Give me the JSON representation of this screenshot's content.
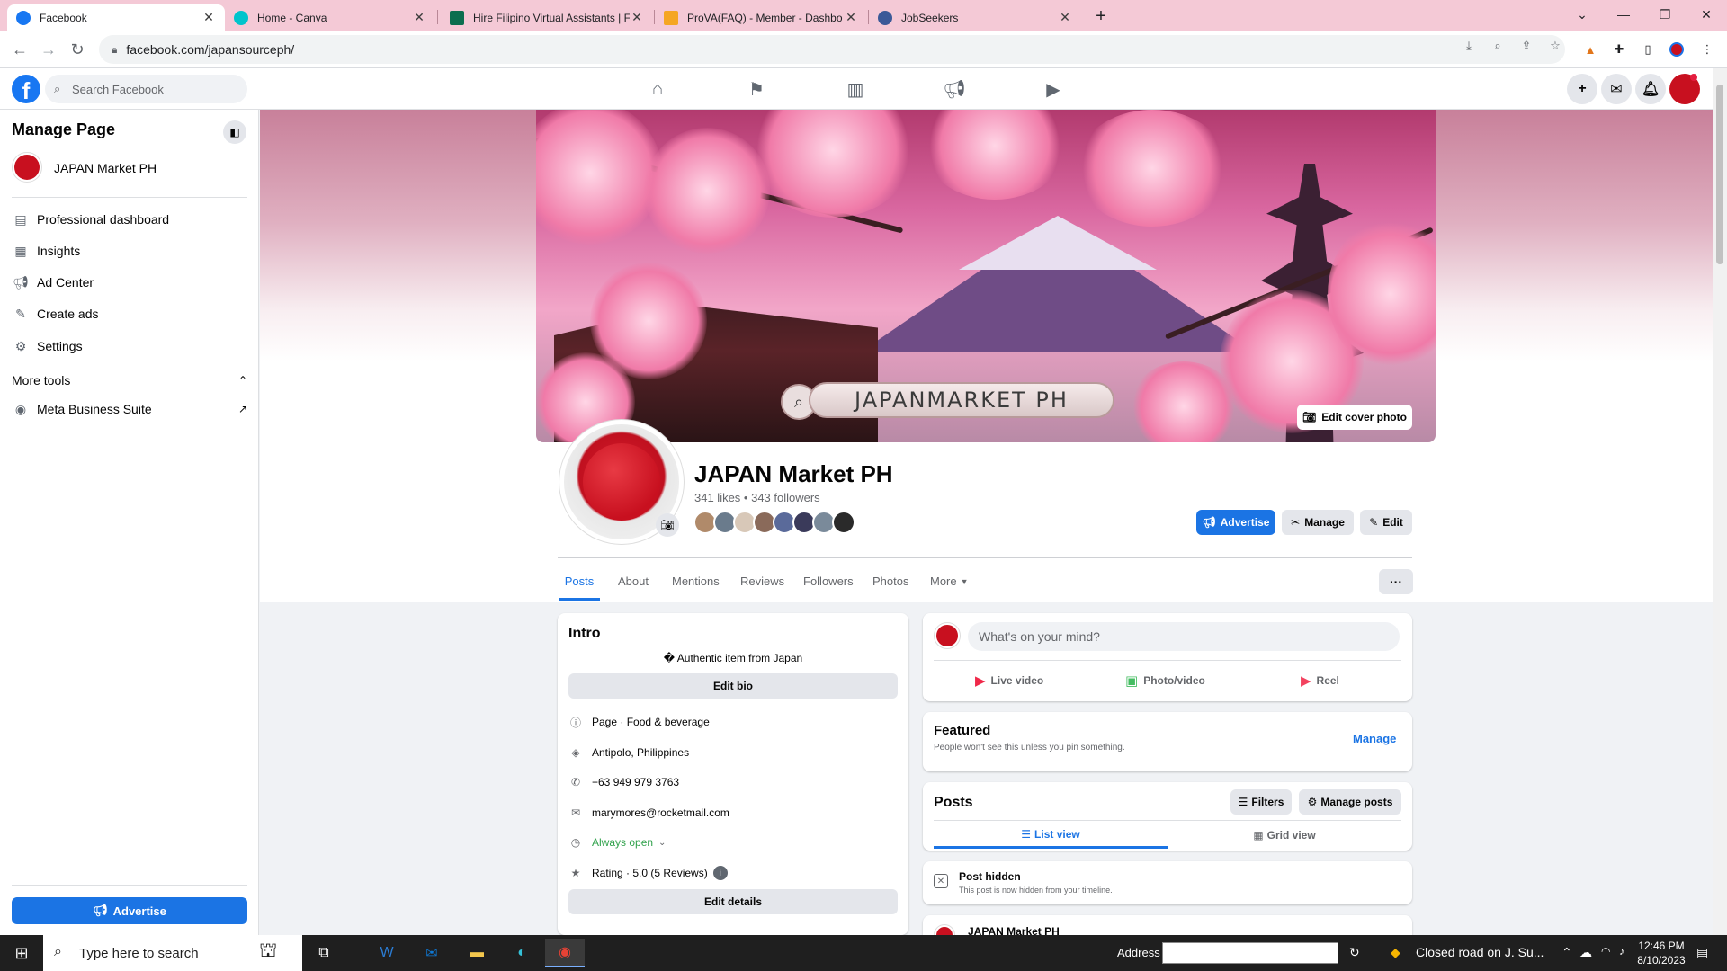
{
  "browser": {
    "tabs": [
      {
        "title": "Facebook",
        "active": true,
        "favicon_color": "#1877f2"
      },
      {
        "title": "Home - Canva",
        "active": false,
        "favicon_color": "#00c4cc"
      },
      {
        "title": "Hire Filipino Virtual Assistants | Fi",
        "active": false,
        "favicon_color": "#0b6e4f"
      },
      {
        "title": "ProVA(FAQ) - Member - Dashbo",
        "active": false,
        "favicon_color": "#f5a623"
      },
      {
        "title": "JobSeekers",
        "active": false,
        "favicon_color": "#3b5998"
      }
    ],
    "url": "facebook.com/japansourceph/"
  },
  "facebook": {
    "search_placeholder": "Search Facebook",
    "brand_color": "#1877f2"
  },
  "sidebar": {
    "title": "Manage Page",
    "page_name": "JAPAN Market PH",
    "items": [
      {
        "label": "Professional dashboard",
        "icon": "dashboard-icon"
      },
      {
        "label": "Insights",
        "icon": "insights-icon"
      },
      {
        "label": "Ad Center",
        "icon": "megaphone-icon"
      },
      {
        "label": "Create ads",
        "icon": "pencil-icon"
      },
      {
        "label": "Settings",
        "icon": "gear-icon"
      }
    ],
    "more_tools_label": "More tools",
    "meta_suite_label": "Meta Business Suite",
    "advertise_label": "Advertise"
  },
  "cover": {
    "banner_text": "JAPANMARKET PH",
    "edit_cover_label": "Edit cover photo"
  },
  "profile": {
    "name": "JAPAN Market PH",
    "stats": "341 likes • 343 followers",
    "follower_avatar_colors": [
      "#b08a6a",
      "#6a7b8c",
      "#d8c8b8",
      "#8a6a5a",
      "#5a6a9a",
      "#3a3a5a",
      "#7a8a9a",
      "#2a2a2a"
    ],
    "buttons": {
      "advertise": "Advertise",
      "manage": "Manage",
      "edit": "Edit"
    },
    "tabs": [
      "Posts",
      "About",
      "Mentions",
      "Reviews",
      "Followers",
      "Photos",
      "More"
    ],
    "active_tab": "Posts"
  },
  "intro": {
    "title": "Intro",
    "bio": "� Authentic item from Japan",
    "edit_bio_label": "Edit bio",
    "rows": [
      {
        "text": "Page · Food & beverage",
        "icon": "info-icon"
      },
      {
        "text": "Antipolo, Philippines",
        "icon": "location-icon"
      },
      {
        "text": "+63 949 979 3763",
        "icon": "phone-icon"
      },
      {
        "text": "marymores@rocketmail.com",
        "icon": "mail-icon"
      },
      {
        "text": "Always open",
        "icon": "clock-icon"
      },
      {
        "text": "Rating · 5.0 (5 Reviews)",
        "icon": "star-icon"
      }
    ],
    "edit_details_label": "Edit details"
  },
  "composer": {
    "placeholder": "What's on your mind?",
    "live_label": "Live video",
    "photo_label": "Photo/video",
    "reel_label": "Reel"
  },
  "featured": {
    "title": "Featured",
    "subtitle": "People won't see this unless you pin something.",
    "manage_label": "Manage"
  },
  "posts": {
    "title": "Posts",
    "filters_label": "Filters",
    "manage_posts_label": "Manage posts",
    "list_view_label": "List view",
    "grid_view_label": "Grid view",
    "hidden_title": "Post hidden",
    "hidden_text": "This post is now hidden from your timeline.",
    "next_post_author": "JAPAN Market PH"
  },
  "taskbar": {
    "search_placeholder": "Type here to search",
    "address_label": "Address",
    "weather_text": "Closed road on J. Su...",
    "time": "12:46 PM",
    "date": "8/10/2023"
  }
}
